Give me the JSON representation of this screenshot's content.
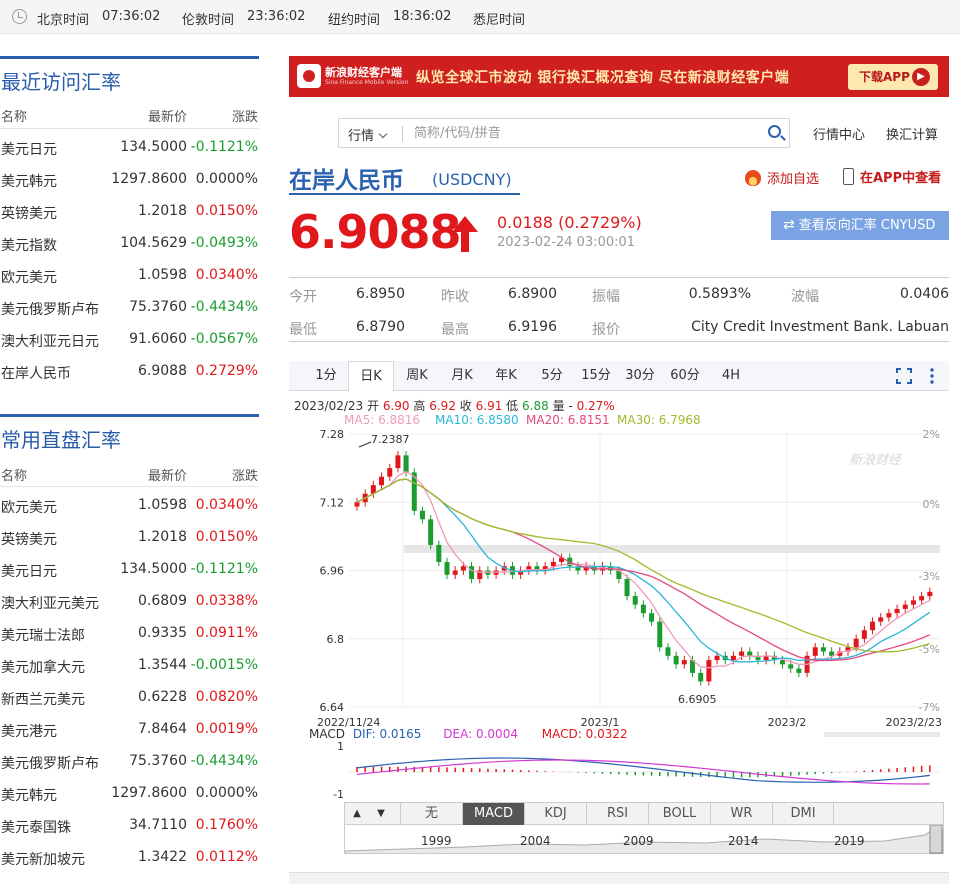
{
  "topbar": {
    "times": [
      "北京时间",
      "07:36:02",
      "伦敦时间",
      "23:36:02",
      "纽约时间",
      "18:36:02",
      "悉尼时间"
    ]
  },
  "recent": {
    "title": "最近访问汇率",
    "headers": [
      "名称",
      "最新价",
      "涨跌"
    ],
    "rows": [
      {
        "name": "美元日元",
        "price": "134.5000",
        "chg": "-0.1121%",
        "dir": "down"
      },
      {
        "name": "美元韩元",
        "price": "1297.8600",
        "chg": "0.0000%",
        "dir": "flat"
      },
      {
        "name": "英镑美元",
        "price": "1.2018",
        "chg": "0.0150%",
        "dir": "up"
      },
      {
        "name": "美元指数",
        "price": "104.5629",
        "chg": "-0.0493%",
        "dir": "down"
      },
      {
        "name": "欧元美元",
        "price": "1.0598",
        "chg": "0.0340%",
        "dir": "up"
      },
      {
        "name": "美元俄罗斯卢布",
        "price": "75.3760",
        "chg": "-0.4434%",
        "dir": "down"
      },
      {
        "name": "澳大利亚元日元",
        "price": "91.6060",
        "chg": "-0.0567%",
        "dir": "down"
      },
      {
        "name": "在岸人民币",
        "price": "6.9088",
        "chg": "0.2729%",
        "dir": "up"
      }
    ]
  },
  "direct": {
    "title": "常用直盘汇率",
    "headers": [
      "名称",
      "最新价",
      "涨跌"
    ],
    "rows": [
      {
        "name": "欧元美元",
        "price": "1.0598",
        "chg": "0.0340%",
        "dir": "up"
      },
      {
        "name": "英镑美元",
        "price": "1.2018",
        "chg": "0.0150%",
        "dir": "up"
      },
      {
        "name": "美元日元",
        "price": "134.5000",
        "chg": "-0.1121%",
        "dir": "down"
      },
      {
        "name": "澳大利亚元美元",
        "price": "0.6809",
        "chg": "0.0338%",
        "dir": "up"
      },
      {
        "name": "美元瑞士法郎",
        "price": "0.9335",
        "chg": "0.0911%",
        "dir": "up"
      },
      {
        "name": "美元加拿大元",
        "price": "1.3544",
        "chg": "-0.0015%",
        "dir": "down"
      },
      {
        "name": "新西兰元美元",
        "price": "0.6228",
        "chg": "0.0820%",
        "dir": "up"
      },
      {
        "name": "美元港元",
        "price": "7.8464",
        "chg": "0.0019%",
        "dir": "up"
      },
      {
        "name": "美元俄罗斯卢布",
        "price": "75.3760",
        "chg": "-0.4434%",
        "dir": "down"
      },
      {
        "name": "美元韩元",
        "price": "1297.8600",
        "chg": "0.0000%",
        "dir": "flat"
      },
      {
        "name": "美元泰国铢",
        "price": "34.7110",
        "chg": "0.1760%",
        "dir": "up"
      },
      {
        "name": "美元新加坡元",
        "price": "1.3422",
        "chg": "0.0112%",
        "dir": "up"
      }
    ]
  },
  "banner": {
    "brand": "新浪财经客户端",
    "brand_sub": "Sina Finance Mobile Version",
    "slogan": "纵览全球汇市波动 银行换汇概况查询 尽在新浪财经客户端",
    "download": "下载APP"
  },
  "search": {
    "select": "行情",
    "placeholder": "简称/代码/拼音",
    "links": [
      "行情中心",
      "换汇计算"
    ]
  },
  "quote": {
    "name": "在岸人民币",
    "code": "(USDCNY)",
    "add_fav": "添加自选",
    "view_app": "在APP中查看",
    "price": "6.9088",
    "change": "0.0188 (0.2729%)",
    "time": "2023-02-24 03:00:01",
    "reverse": "查看反向汇率 CNYUSD"
  },
  "stats": [
    {
      "label": "今开",
      "value": "6.8950"
    },
    {
      "label": "昨收",
      "value": "6.8900"
    },
    {
      "label": "振幅",
      "value": "0.5893%"
    },
    {
      "label": "波幅",
      "value": "0.0406"
    },
    {
      "label": "最低",
      "value": "6.8790"
    },
    {
      "label": "最高",
      "value": "6.9196"
    },
    {
      "label": "报价",
      "value": "City Credit Investment Bank. Labuan"
    }
  ],
  "chart_tabs": [
    "1分",
    "日K",
    "周K",
    "月K",
    "年K",
    "5分",
    "15分",
    "30分",
    "60分",
    "4H"
  ],
  "chart_data": {
    "type": "candlestick",
    "ohlc_label": {
      "date": "2023/02/23",
      "open_l": "开",
      "open": "6.90",
      "high_l": "高",
      "high": "6.92",
      "close_l": "收",
      "close": "6.91",
      "low_l": "低",
      "low": "6.88",
      "vol_l": "量",
      "vol": "-",
      "chg": "0.27%"
    },
    "ma": [
      {
        "name": "MA5",
        "value": "6.8816",
        "color": "#f09abb"
      },
      {
        "name": "MA10",
        "value": "6.8580",
        "color": "#2bb6d7"
      },
      {
        "name": "MA20",
        "value": "6.8151",
        "color": "#e2497e"
      },
      {
        "name": "MA30",
        "value": "6.7968",
        "color": "#9ebc2b"
      }
    ],
    "y_ticks": [
      "7.28",
      "7.12",
      "6.96",
      "6.8",
      "6.64"
    ],
    "pct_ticks": [
      "2%",
      "0%",
      "-3%",
      "-5%",
      "-7%"
    ],
    "x_ticks": [
      "2022/11/24",
      "2023/1",
      "2023/2",
      "2023/2/23"
    ],
    "ylim": [
      6.64,
      7.28
    ],
    "max_label": "7.2387",
    "min_label": "6.6905",
    "watermark": "新浪财经",
    "closes": [
      7.12,
      7.14,
      7.16,
      7.18,
      7.2,
      7.23,
      7.19,
      7.1,
      7.08,
      7.02,
      6.98,
      6.95,
      6.96,
      6.97,
      6.94,
      6.96,
      6.95,
      6.96,
      6.97,
      6.95,
      6.96,
      6.97,
      6.96,
      6.97,
      6.98,
      6.99,
      6.97,
      6.96,
      6.97,
      6.96,
      6.97,
      6.96,
      6.94,
      6.9,
      6.88,
      6.86,
      6.84,
      6.78,
      6.76,
      6.74,
      6.75,
      6.72,
      6.7,
      6.75,
      6.76,
      6.75,
      6.76,
      6.77,
      6.76,
      6.75,
      6.76,
      6.75,
      6.74,
      6.73,
      6.72,
      6.76,
      6.78,
      6.77,
      6.76,
      6.77,
      6.78,
      6.8,
      6.82,
      6.84,
      6.85,
      6.86,
      6.87,
      6.88,
      6.89,
      6.9,
      6.91
    ],
    "macd": {
      "label": "MACD",
      "dif_l": "DIF:",
      "dif": "0.0165",
      "dea_l": "DEA:",
      "dea": "0.0004",
      "macd_l": "MACD:",
      "macd": "0.0322",
      "ticks": [
        "1",
        "-1"
      ]
    },
    "indicator_tabs": [
      "无",
      "MACD",
      "KDJ",
      "RSI",
      "BOLL",
      "WR",
      "DMI"
    ],
    "years": [
      "1999",
      "2004",
      "2009",
      "2014",
      "2019"
    ]
  }
}
